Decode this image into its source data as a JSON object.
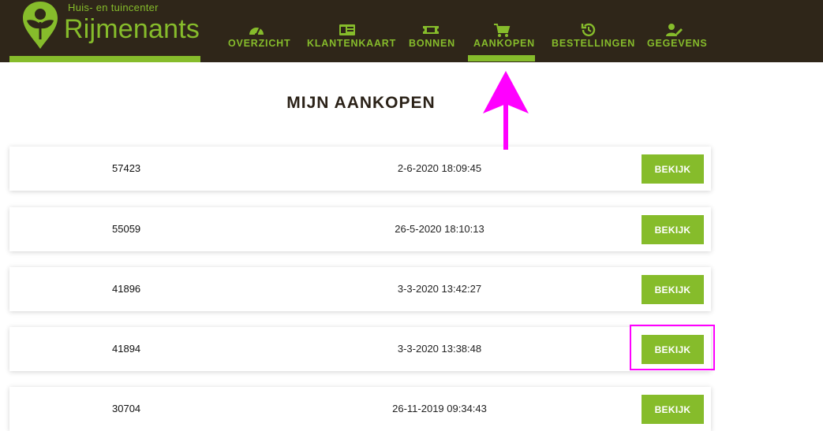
{
  "brand": {
    "tagline": "Huis- en tuincenter",
    "name": "Rijmenants",
    "color": "#86bc2b",
    "header_bg": "#2f2619"
  },
  "nav": {
    "items": [
      {
        "label": "OVERZICHT",
        "icon": "dashboard-gauge-icon"
      },
      {
        "label": "KLANTENKAART",
        "icon": "id-card-icon"
      },
      {
        "label": "BONNEN",
        "icon": "ticket-icon"
      },
      {
        "label": "AANKOPEN",
        "icon": "shopping-cart-icon",
        "active": true
      },
      {
        "label": "BESTELLINGEN",
        "icon": "history-clock-icon"
      },
      {
        "label": "GEGEVENS",
        "icon": "user-edit-icon"
      }
    ]
  },
  "page": {
    "title": "MIJN AANKOPEN"
  },
  "purchases": [
    {
      "number": "57423",
      "date": "2-6-2020 18:09:45",
      "button": "BEKIJK"
    },
    {
      "number": "55059",
      "date": "26-5-2020 18:10:13",
      "button": "BEKIJK"
    },
    {
      "number": "41896",
      "date": "3-3-2020 13:42:27",
      "button": "BEKIJK"
    },
    {
      "number": "41894",
      "date": "3-3-2020 13:38:48",
      "button": "BEKIJK"
    },
    {
      "number": "30704",
      "date": "26-11-2019 09:34:43",
      "button": "BEKIJK"
    }
  ],
  "annotations": {
    "color": "#ff00ff"
  }
}
